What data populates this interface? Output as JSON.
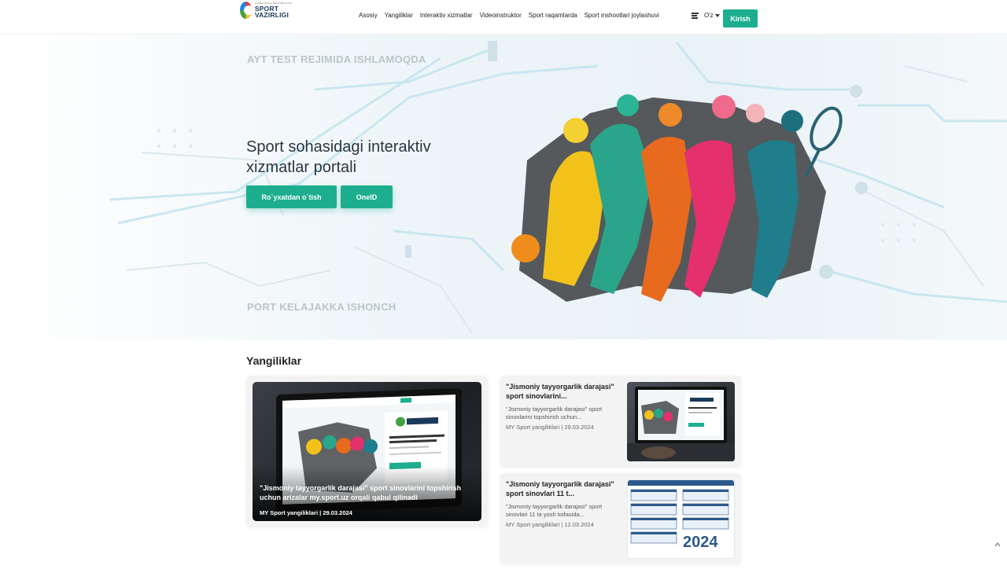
{
  "header": {
    "logo_small": "O'ZBEKISTON RESPUBLIKASI",
    "logo_text": "SPORT VAZIRLIGI",
    "nav": [
      "Asosiy",
      "Yangiliklar",
      "Interaktiv xizmatlar",
      "Videoinstruktor",
      "Sport raqamlarda",
      "Sport inshootlari joylashuvi"
    ],
    "lang": "O'z",
    "login": "Kirish"
  },
  "hero": {
    "tagline_top": "AYT TEST REJIMIDA ISHLAMOQDA",
    "title": "Sport sohasidagi interaktiv xizmatlar portali",
    "btn_register": "Ro`yxatdan o`tish",
    "btn_oneid": "OneID",
    "tagline_bottom": "PORT KELAJAKKA ISHONCH"
  },
  "news": {
    "section_title": "Yangiliklar",
    "featured": {
      "title": "\"Jismoniy tayyorgarlik darajasi\" sport sinovlarini topshirish uchun arizalar my.sport.uz orqali qabul qilinadi",
      "meta": "MY Sport yangiliklari | 29.03.2024"
    },
    "items": [
      {
        "title": "\"Jismoniy tayyorgarlik darajasi\" sport sinovlarini...",
        "desc": "\"Jismoniy tayyorgarlik darajasi\" sport sinovlarini topshirish uchun...",
        "meta": "MY Sport yangiliklari | 29.03.2024"
      },
      {
        "title": "\"Jismoniy tayyorgarlik darajasi\" sport sinovlari 11 t...",
        "desc": "\"Jismoniy tayyorgarlik darajasi\" sport sinovlari 11 ta yosh toifasida...",
        "meta": "MY Sport yangiliklari | 12.03.2024",
        "image_text": "2024"
      }
    ]
  },
  "colors": {
    "accent": "#1cae8f",
    "brand_dark": "#1a3a5c"
  },
  "icons": [
    "menu-icon",
    "chevron-down-icon",
    "chevron-up-icon"
  ]
}
